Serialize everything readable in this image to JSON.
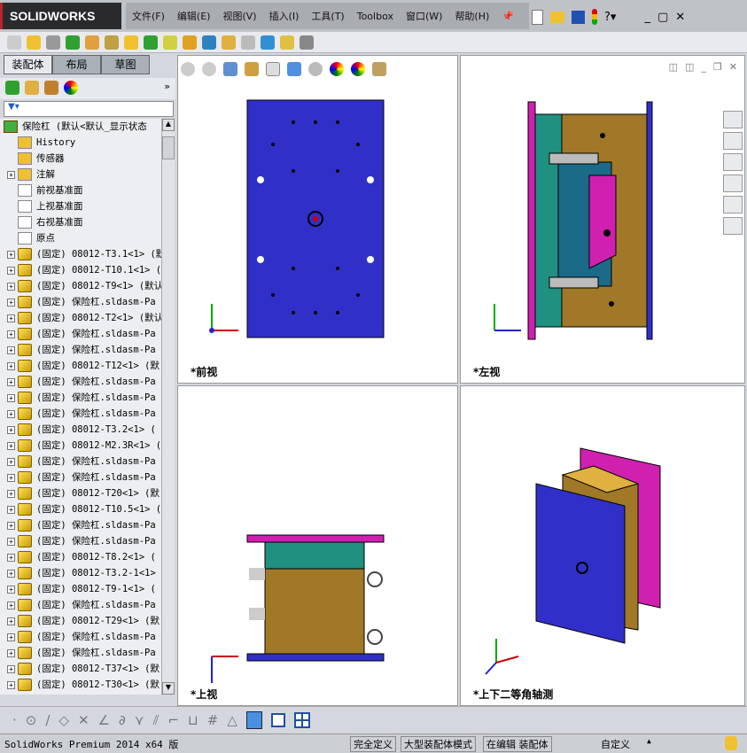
{
  "app": {
    "logo": "SOLIDWORKS"
  },
  "menu": [
    "文件(F)",
    "编辑(E)",
    "视图(V)",
    "插入(I)",
    "工具(T)",
    "Toolbox",
    "窗口(W)",
    "帮助(H)"
  ],
  "tabs": [
    "装配体",
    "布局",
    "草图"
  ],
  "tree": {
    "root": "保险杠 (默认<默认_显示状态",
    "items": [
      "History",
      "传感器",
      "注解",
      "前视基准面",
      "上视基准面",
      "右视基准面",
      "原点"
    ],
    "parts": [
      "(固定) 08012-T3.1<1> (默",
      "(固定) 08012-T10.1<1> (",
      "(固定) 08012-T9<1> (默认",
      "(固定) 保险杠.sldasm-Pa",
      "(固定) 08012-T2<1> (默认",
      "(固定) 保险杠.sldasm-Pa",
      "(固定) 保险杠.sldasm-Pa",
      "(固定) 08012-T12<1> (默",
      "(固定) 保险杠.sldasm-Pa",
      "(固定) 保险杠.sldasm-Pa",
      "(固定) 保险杠.sldasm-Pa",
      "(固定) 08012-T3.2<1> (",
      "(固定) 08012-M2.3R<1> (",
      "(固定) 保险杠.sldasm-Pa",
      "(固定) 保险杠.sldasm-Pa",
      "(固定) 08012-T20<1> (默",
      "(固定) 08012-T10.5<1> (",
      "(固定) 保险杠.sldasm-Pa",
      "(固定) 保险杠.sldasm-Pa",
      "(固定) 08012-T8.2<1> (",
      "(固定) 08012-T3.2-1<1>",
      "(固定) 08012-T9-1<1> (",
      "(固定) 保险杠.sldasm-Pa",
      "(固定) 08012-T29<1> (默",
      "(固定) 保险杠.sldasm-Pa",
      "(固定) 保险杠.sldasm-Pa",
      "(固定) 08012-T37<1> (默",
      "(固定) 08012-T30<1> (默"
    ]
  },
  "viewports": {
    "front": "*前视",
    "left": "*左视",
    "top": "*上视",
    "iso": "*上下二等角轴测"
  },
  "status": {
    "version": "SolidWorks Premium 2014 x64 版",
    "defined": "完全定义",
    "mode": "大型装配体模式",
    "editing": "在编辑 装配体",
    "custom": "自定义"
  },
  "colors": {
    "plate": "#3030c8",
    "magenta": "#d020b0",
    "teal": "#209080",
    "brown": "#a07828",
    "accent": "#c0202a"
  }
}
